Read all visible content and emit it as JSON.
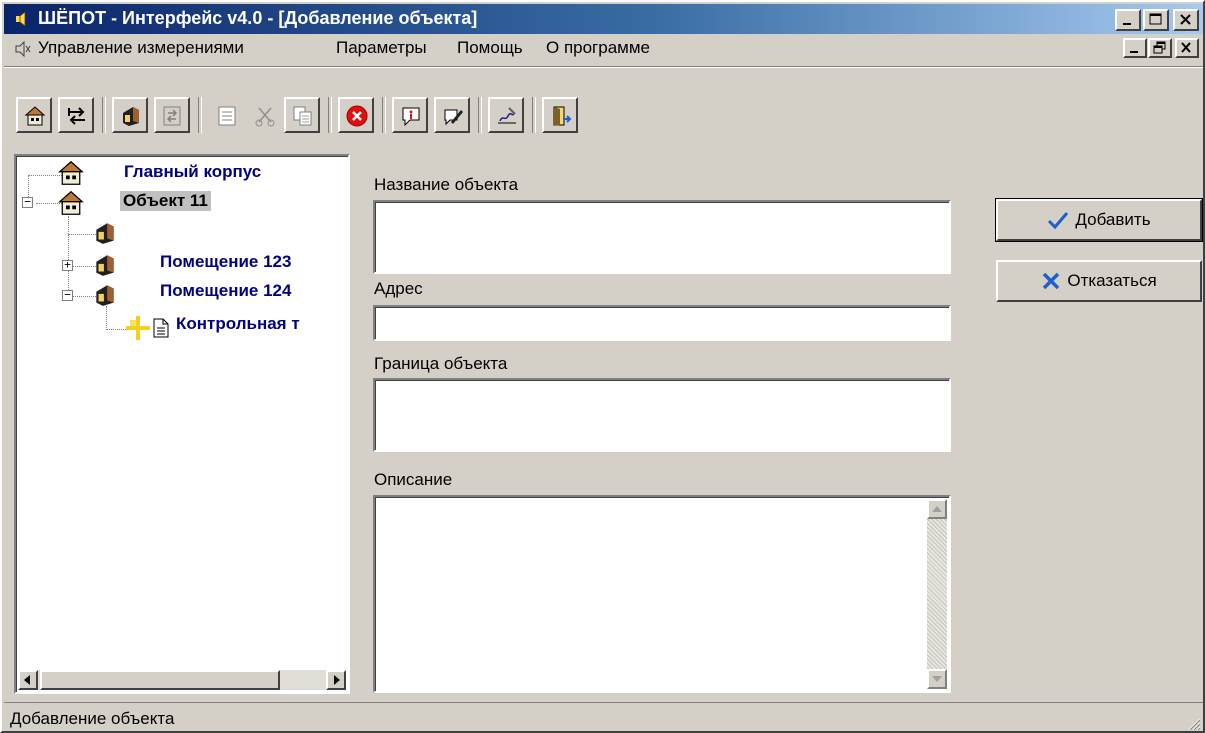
{
  "window": {
    "title": "ШЁПОТ - Интерфейс v4.0 - [Добавление объекта]"
  },
  "menu": {
    "items": [
      "Управление измерениями",
      "Параметры",
      "Помощь",
      "О программе"
    ]
  },
  "toolbar": {
    "buttons": [
      {
        "icon": "building-icon"
      },
      {
        "icon": "swap-arrows-icon"
      },
      {
        "icon": "room-icon"
      },
      {
        "icon": "swap-arrows-disabled-icon"
      },
      {
        "icon": "list-disabled-icon"
      },
      {
        "icon": "cut-disabled-icon"
      },
      {
        "icon": "copy-disabled-icon"
      },
      {
        "icon": "delete-icon"
      },
      {
        "icon": "info-icon"
      },
      {
        "icon": "edit-icon"
      },
      {
        "icon": "sign-icon"
      },
      {
        "icon": "exit-icon"
      }
    ]
  },
  "tree": {
    "nodes": [
      {
        "label": "Главный корпус"
      },
      {
        "label": "Объект 11",
        "selected": true
      },
      {
        "label": ""
      },
      {
        "label": "Помещение 123"
      },
      {
        "label": "Помещение 124"
      },
      {
        "label": "Контрольная т"
      }
    ]
  },
  "form": {
    "name_label": "Название объекта",
    "name_value": "",
    "address_label": "Адрес",
    "address_value": "",
    "border_label": "Граница объекта",
    "border_value": "",
    "description_label": "Описание",
    "description_value": ""
  },
  "actions": {
    "add_label": "Добавить",
    "cancel_label": "Отказаться"
  },
  "status": {
    "text": "Добавление объекта"
  },
  "colors": {
    "title_gradient_start": "#0a246a",
    "tree_text": "#000080",
    "add_check": "#1c5fd0",
    "cancel_x": "#1c5fd0",
    "delete_red": "#e01010"
  }
}
